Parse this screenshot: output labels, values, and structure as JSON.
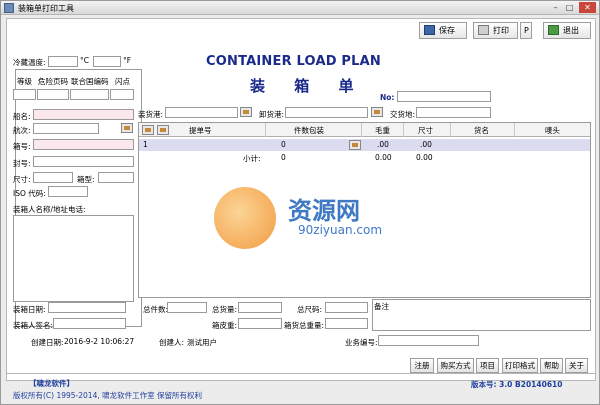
{
  "window": {
    "title": "装箱单打印工具"
  },
  "toolbar": {
    "save_label": "保存",
    "print_label": "打印",
    "p_label": "P",
    "exit_label": "退出"
  },
  "header": {
    "title": "CONTAINER LOAD PLAN",
    "subtitle": "装 箱 单",
    "no_label": "No:"
  },
  "sidebar": {
    "reefer_label": "冷藏温度:",
    "celsius": "°C",
    "fahrenheit": "°F",
    "grade_label": "等级",
    "dangerous_label": "危险页码",
    "un_label": "联合国编码",
    "flash_label": "闪点",
    "vessel_label": "船名:",
    "voyage_label": "航次:",
    "box_no_label": "箱号:",
    "seal_label": "封号:",
    "size_label": "尺寸:",
    "type_label": "箱型:",
    "iso_label": "ISO 代码:",
    "shipper_label": "装箱人名称/地址电话:"
  },
  "ports": {
    "load_label": "装货港:",
    "discharge_label": "卸货港:",
    "delivery_label": "交货地:"
  },
  "grid": {
    "columns": [
      "提单号",
      "件数包装",
      "毛重",
      "尺寸",
      "货名",
      "唛头"
    ],
    "row1": {
      "index": "1",
      "pieces": "0",
      "weight": ".00",
      "size": ".00"
    },
    "row2": {
      "subtotal_label": "小计:",
      "pieces": "0",
      "weight": "0.00",
      "size": "0.00"
    }
  },
  "bottom": {
    "pack_date_label": "装箱日期:",
    "total_pieces_label": "总件数:",
    "total_weight_label": "总货量:",
    "total_size_label": "总尺码:",
    "remark_label": "备注",
    "signer_label": "装箱人签名:",
    "box_weight_label": "箱皮重:",
    "box_total_label": "箱货总重量:",
    "created_date_label": "创建日期:",
    "created_date": "2016-9-2 10:06:27",
    "creator_label": "创建人:",
    "creator": "测试用户",
    "business_no_label": "业务编号:"
  },
  "footer_buttons": [
    "注册",
    "购买方式",
    "项目",
    "打印格式",
    "帮助",
    "关于"
  ],
  "footer": {
    "logo": "【啸龙软件】",
    "copyright": "版权所有(C) 1995-2014, 啸龙软件工作室 保留所有权利",
    "version": "版本号: 3.0 B20140610"
  },
  "watermark": {
    "text": "资源网",
    "url": "90ziyuan.com"
  },
  "colors": {
    "accent": "#1a2a8a",
    "pink_field": "#fbe8ec",
    "selected_row": "#dcdcf0"
  }
}
